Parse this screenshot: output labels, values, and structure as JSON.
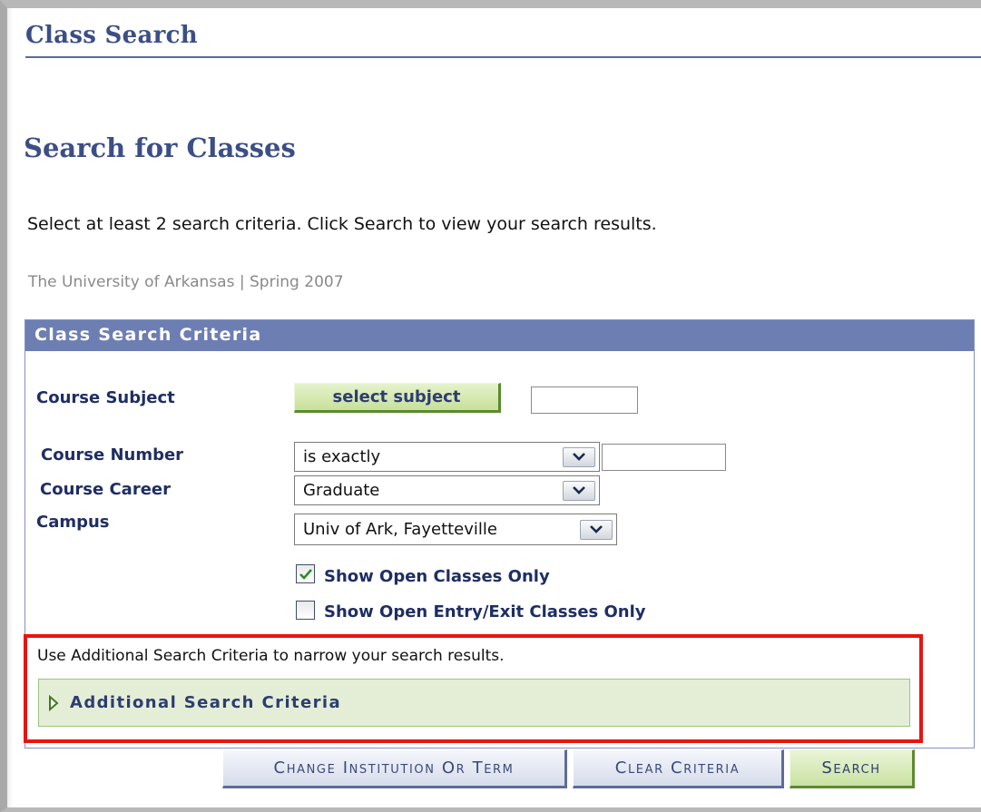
{
  "page": {
    "title": "Class Search",
    "heading": "Search for Classes",
    "instructions": "Select at least 2 search criteria. Click Search to view your search results.",
    "institution_term": "The University of Arkansas | Spring 2007"
  },
  "criteria": {
    "header": "Class Search Criteria",
    "course_subject": {
      "label": "Course Subject",
      "button_label": "select subject",
      "value": ""
    },
    "course_number": {
      "label": "Course Number",
      "operator": "is exactly",
      "value": ""
    },
    "course_career": {
      "label": "Course Career",
      "value": "Graduate"
    },
    "campus": {
      "label": "Campus",
      "value": "Univ of Ark, Fayetteville"
    },
    "open_classes_only": {
      "label": "Show Open Classes Only",
      "checked": true
    },
    "open_entry_exit_only": {
      "label": "Show Open Entry/Exit Classes Only",
      "checked": false
    }
  },
  "additional": {
    "note": "Use Additional Search Criteria to narrow your search results.",
    "panel_label": "Additional Search Criteria"
  },
  "actions": {
    "change_institution": "Change Institution Or Term",
    "clear_criteria": "Clear Criteria",
    "search": "Search"
  },
  "colors": {
    "title_blue": "#3c4e86",
    "header_bar": "#6d7eb2",
    "highlight_red": "#e8150f",
    "panel_green": "#e4eed7"
  },
  "icons": {
    "dropdown": "chevron-down-icon",
    "expand": "triangle-right-icon",
    "checked": "checkmark-icon"
  }
}
